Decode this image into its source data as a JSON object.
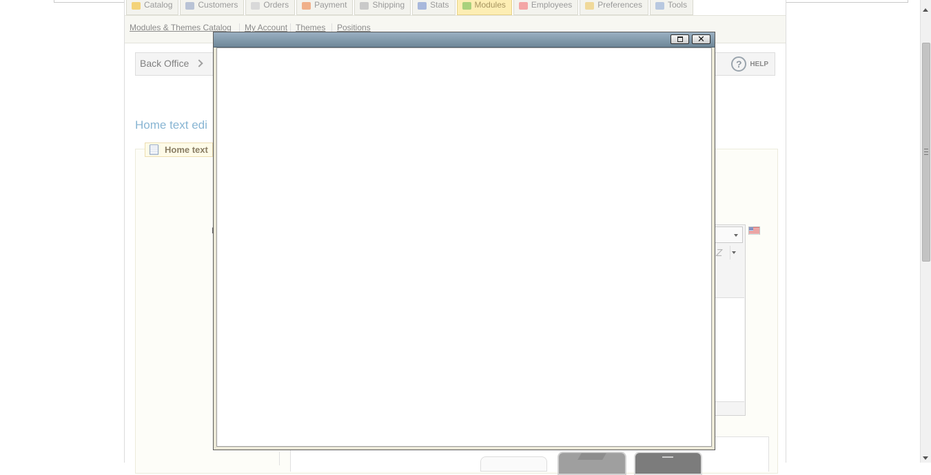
{
  "tabs": [
    {
      "label": "Catalog",
      "color": "#f3d37a"
    },
    {
      "label": "Customers",
      "color": "#b9c3d6"
    },
    {
      "label": "Orders",
      "color": "#d9d9d9"
    },
    {
      "label": "Payment",
      "color": "#f0b08a"
    },
    {
      "label": "Shipping",
      "color": "#c9c9c9"
    },
    {
      "label": "Stats",
      "color": "#a8b8dc"
    },
    {
      "label": "Modules",
      "color": "#a9d17c",
      "active": true
    },
    {
      "label": "Employees",
      "color": "#f3a6a6"
    },
    {
      "label": "Preferences",
      "color": "#f0d99a"
    },
    {
      "label": "Tools",
      "color": "#b8c8e0"
    }
  ],
  "subnav": {
    "links": [
      "Modules & Themes Catalog",
      "My Account",
      "Themes",
      "Positions"
    ]
  },
  "breadcrumb": {
    "root": "Back Office",
    "next": "I"
  },
  "help": {
    "label": "HELP",
    "glyph": "?"
  },
  "page_title": "Home text edi",
  "fieldset": {
    "legend": "Home text"
  },
  "fragment_label": "I",
  "editor": {
    "button_glyph": "Z"
  },
  "modal": {
    "close_glyph": "✕"
  },
  "colors": {
    "title_blue": "#88b5d3",
    "modal_titlebar": "#7f97a8",
    "active_tab": "#fdeeb4"
  }
}
